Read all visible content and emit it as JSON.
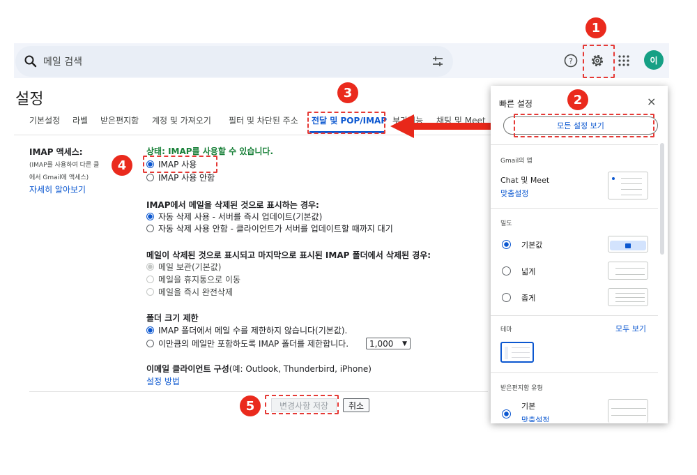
{
  "search": {
    "placeholder": "메일 검색"
  },
  "header": {
    "avatar_letter": "이"
  },
  "steps": [
    "1",
    "2",
    "3",
    "4",
    "5"
  ],
  "settings": {
    "title": "설정",
    "tabs": [
      {
        "label": "기본설정"
      },
      {
        "label": "라벨"
      },
      {
        "label": "받은편지함"
      },
      {
        "label": "계정 및 가져오기"
      },
      {
        "label": "필터 및 차단된 주소"
      },
      {
        "label": "전달 및 POP/IMAP"
      },
      {
        "label": "부가기능"
      },
      {
        "label": "채팅 및 Meet"
      }
    ],
    "imap_access": {
      "label": "IMAP 액세스:",
      "desc_line1": "(IMAP를 사용하여 다른 클",
      "desc_line2": "에서 Gmail에 액세스)",
      "learn_more": "자세히 알아보기",
      "status_prefix": "상태: ",
      "status_value": "IMAP를 사용할 수 있습니다.",
      "enable": "IMAP 사용",
      "disable": "IMAP 사용 안함"
    },
    "deleted_group": {
      "title": "IMAP에서 메일을 삭제된 것으로 표시하는 경우:",
      "opt1": "자동 삭제 사용 - 서버를 즉시 업데이트(기본값)",
      "opt2": "자동 삭제 사용 안함 - 클라이언트가 서버를 업데이트할 때까지 대기"
    },
    "expunge_group": {
      "title": "메일이 삭제된 것으로 표시되고 마지막으로 표시된 IMAP 폴더에서 삭제된 경우:",
      "opt1": "메일 보관(기본값)",
      "opt2": "메일을 휴지통으로 이동",
      "opt3": "메일을 즉시 완전삭제"
    },
    "folder_limit": {
      "title": "폴더 크기 제한",
      "opt1": "IMAP 폴더에서 메일 수를 제한하지 않습니다(기본값).",
      "opt2": "이만큼의 메일만 포함하도록 IMAP 폴더를 제한합니다.",
      "select_value": "1,000"
    },
    "client_config": {
      "title": "이메일 클라이언트 구성",
      "examples": "(예: Outlook, Thunderbird, iPhone)",
      "howto": "설정 방법"
    },
    "save_label": "변경사항 저장",
    "cancel_label": "취소"
  },
  "quick": {
    "title": "빠른 설정",
    "close": "×",
    "see_all": "모든 설정 보기",
    "apps_title": "Gmail의 앱",
    "apps_item": "Chat 및 Meet",
    "apps_customize": "맞춤설정",
    "density_title": "밀도",
    "density_default": "기본값",
    "density_comfortable": "넓게",
    "density_compact": "좁게",
    "theme_title": "테마",
    "theme_all": "모두 보기",
    "inbox_title": "받은편지함 유형",
    "inbox_default": "기본",
    "inbox_customize": "맞춤설정"
  },
  "colors": {
    "accent": "#0b57d0",
    "annotation": "#ea2a1d",
    "status": "#188038"
  }
}
